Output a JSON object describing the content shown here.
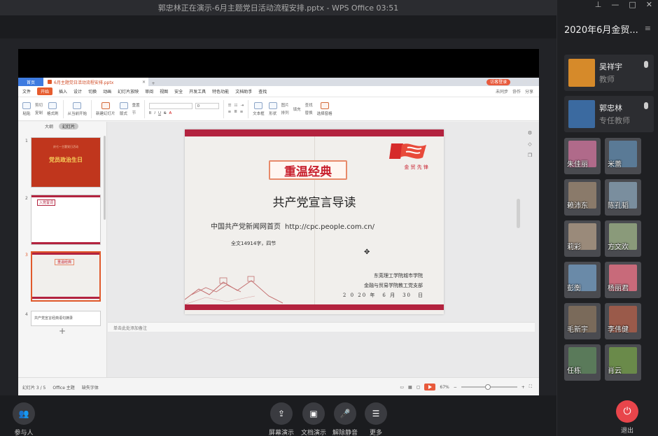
{
  "window": {
    "title": "郭忠林正在演示-6月主题党日活动流程安排.pptx - WPS Office 03:51"
  },
  "wps": {
    "tab_home": "首页",
    "tab_doc": "6月主题党日活动流程安排.pptx",
    "login": "访客登录",
    "menu": [
      "文件",
      "开始",
      "插入",
      "设计",
      "切换",
      "动画",
      "幻灯片放映",
      "审阅",
      "视图",
      "安全",
      "开发工具",
      "特色功能",
      "文档助手",
      "查找"
    ],
    "menu_right": [
      "未同步",
      "协作",
      "分享"
    ],
    "ribbon": {
      "paste": "粘贴",
      "cut": "剪切",
      "copy": "复制",
      "format_painter": "格式刷",
      "from_current": "从当前开始",
      "new_slide": "新建幻灯片",
      "layout": "版式",
      "section": "节",
      "reset": "重置",
      "font_size": "0",
      "textbox": "文本框",
      "shape": "形状",
      "arrange": "排列",
      "picture": "图片",
      "fill": "填充",
      "find": "查找",
      "replace": "替换",
      "select_pane": "选择窗格"
    },
    "thumb_tabs": [
      "大纲",
      "幻灯片"
    ],
    "thumbs": [
      {
        "num": "1",
        "top": "庆七一主题党日活动",
        "title": "党员政治生日"
      },
      {
        "num": "2",
        "title": "入党誓词"
      },
      {
        "num": "3",
        "title": "重温经典"
      },
      {
        "num": "4",
        "title": "共产党宣言经典语句摘录"
      }
    ],
    "slide": {
      "banner": "重温经典",
      "logo_text": "金 贸 先 锋",
      "title": "共产党宣言导读",
      "link_label": "中国共产党新闻网首页",
      "link_url": "http://cpc.people.com.cn/",
      "words": "全文14914字，四节",
      "org1": "东莞理工学院城市学院",
      "org2": "金融与贸易学院教工党支部",
      "date": "2 0 20 年　6 月　30　日"
    },
    "notes_placeholder": "单击此处添加备注",
    "status": {
      "slide_count": "幻灯片 3 / 5",
      "theme": "Office 主题",
      "font_missing": "缺失字体",
      "zoom": "67%"
    }
  },
  "panel": {
    "header": "2020年6月金贸...",
    "hosts": [
      {
        "name": "吴祥宇",
        "role": "教师",
        "color": "#d68a2a"
      },
      {
        "name": "郭忠林",
        "role": "专任教师",
        "color": "#3b6aa0"
      }
    ],
    "students": [
      {
        "name": "朱佳丽",
        "color": "#b06a8a"
      },
      {
        "name": "米蕾",
        "color": "#5a7a96"
      },
      {
        "name": "赖沛东",
        "color": "#8a7a6a"
      },
      {
        "name": "陈孔韬",
        "color": "#7a8e9e"
      },
      {
        "name": "莉彩",
        "color": "#9a8a7a"
      },
      {
        "name": "方文欢",
        "color": "#8a9a7a"
      },
      {
        "name": "彭衡",
        "color": "#6a8aa8"
      },
      {
        "name": "杨丽君",
        "color": "#c86a7a"
      },
      {
        "name": "毛新宇",
        "color": "#7a6a5a"
      },
      {
        "name": "李伟健",
        "color": "#9a5a4a"
      },
      {
        "name": "任栋",
        "color": "#5a7a5a"
      },
      {
        "name": "肖云",
        "color": "#6a8a4a"
      }
    ]
  },
  "toolbar": {
    "participants": "参与人",
    "screen_share": "屏幕演示",
    "doc_share": "文档演示",
    "unmute": "解除静音",
    "more": "更多",
    "exit": "退出"
  }
}
